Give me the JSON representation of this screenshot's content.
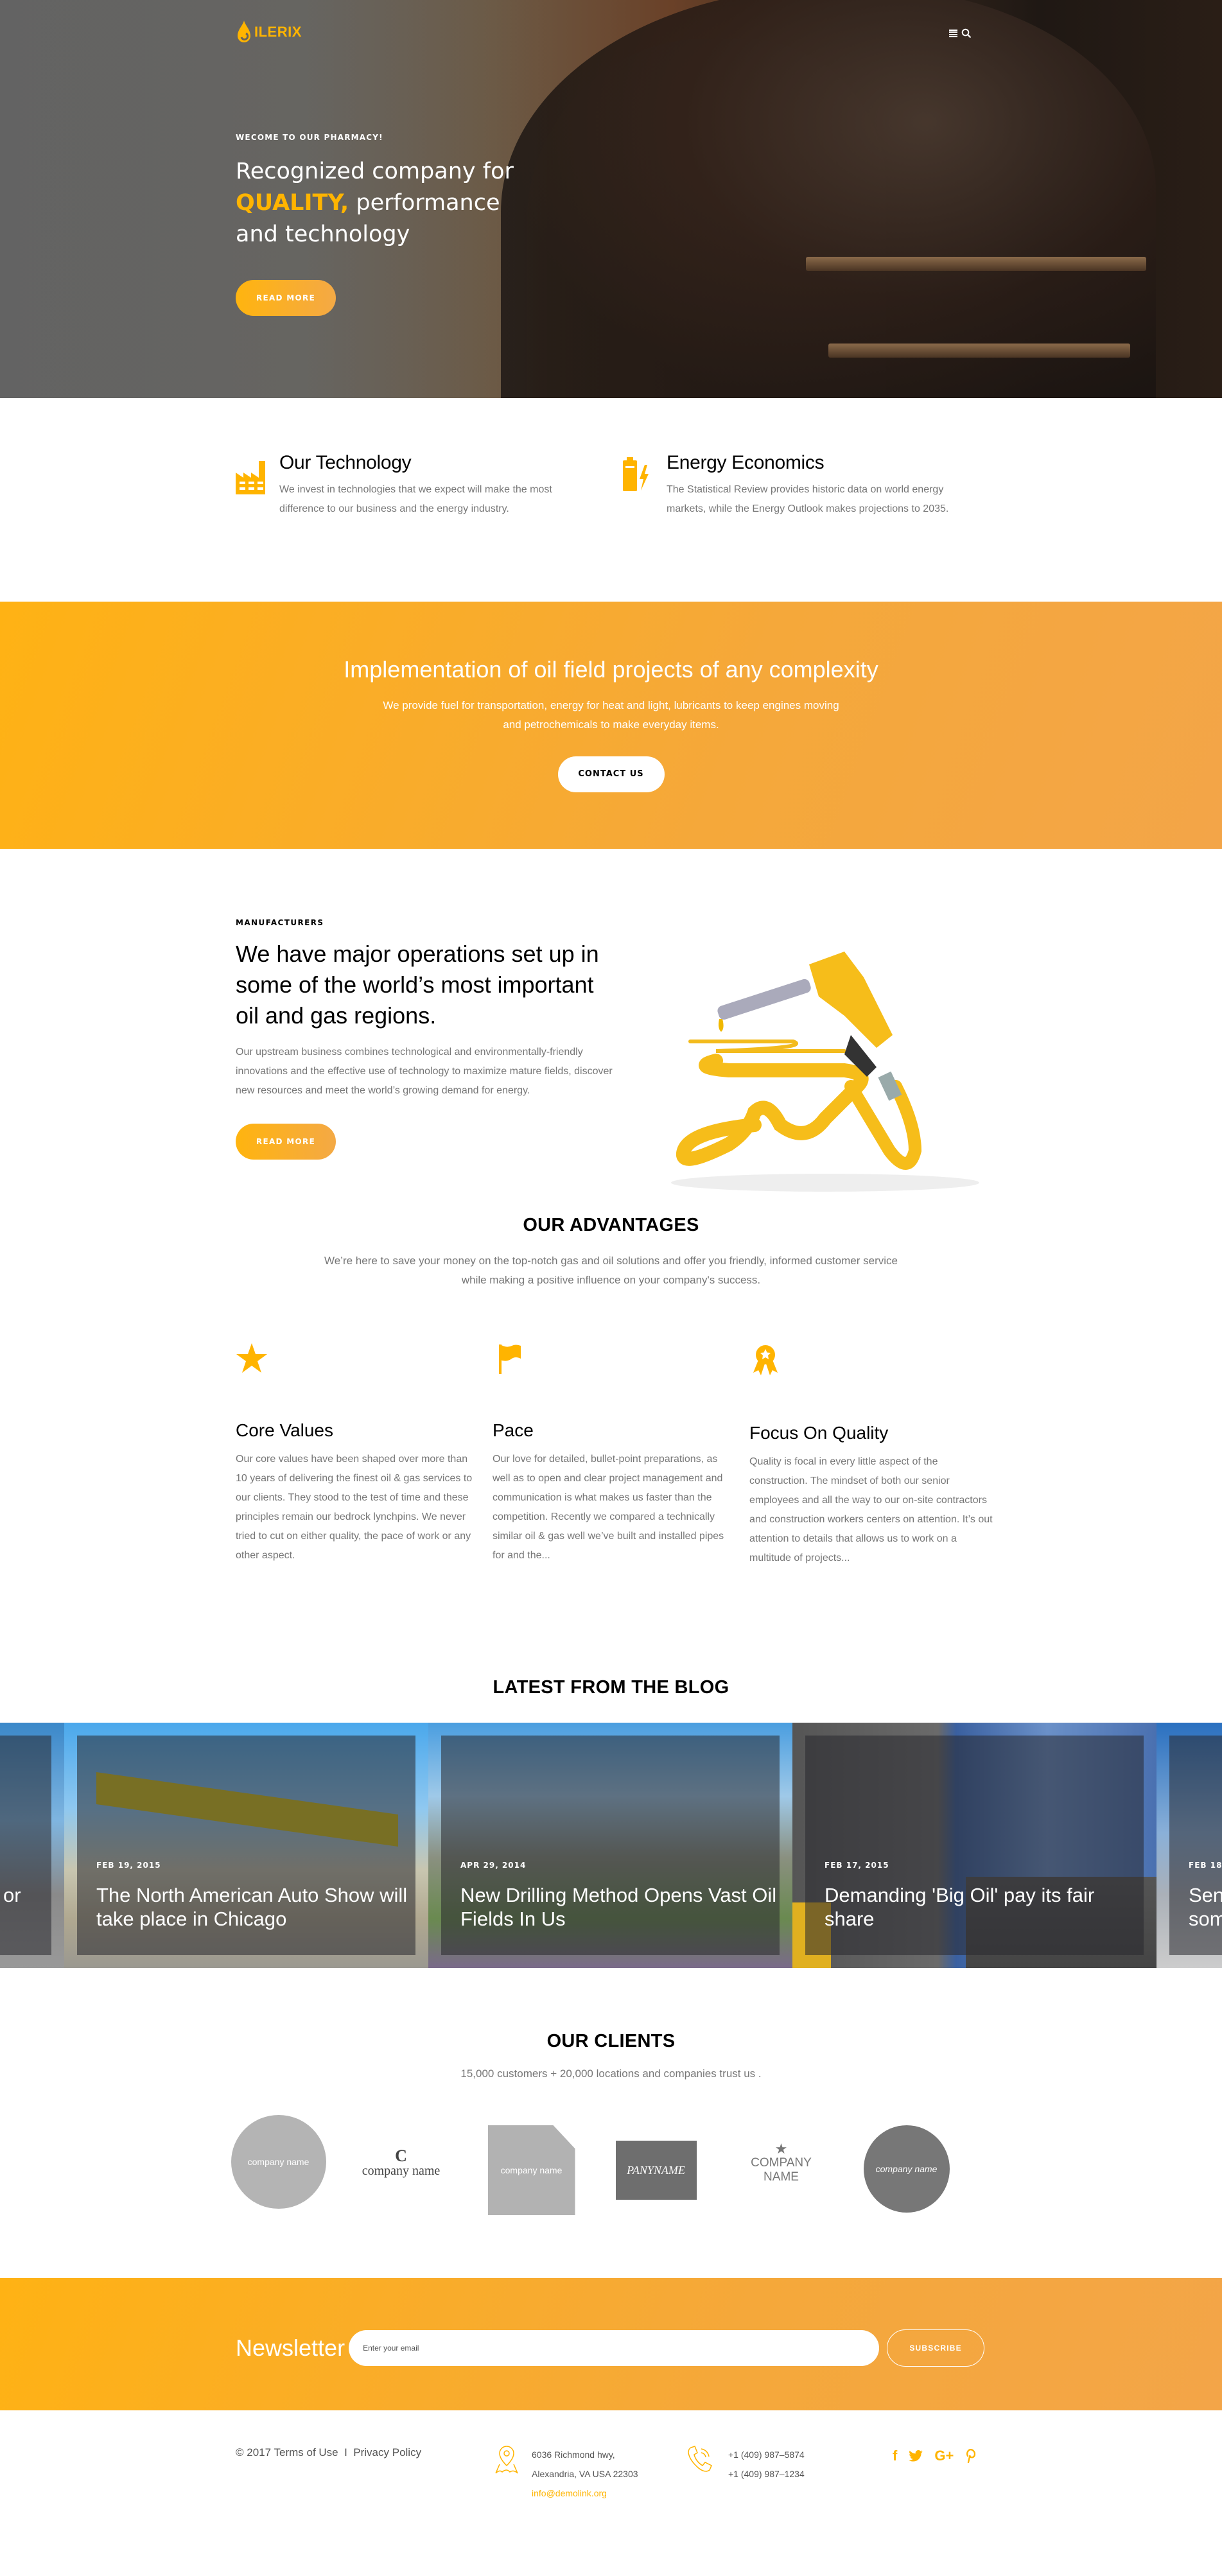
{
  "header": {
    "logo_text": "ILERIX",
    "icons": [
      "menu-icon",
      "search-icon"
    ]
  },
  "hero": {
    "kicker": "WECOME TO OUR PHARMACY!",
    "title_line1": "Recognized company for",
    "title_highlight": "QUALITY,",
    "title_line2_rest": " performance",
    "title_line3": "and technology",
    "button_label": "READ MORE"
  },
  "features": [
    {
      "icon": "factory-icon",
      "title": "Our Technology",
      "text": "We invest in technologies that we expect will make the most difference to our business and the energy industry."
    },
    {
      "icon": "battery-bolt-icon",
      "title": "Energy Economics",
      "text": "The Statistical Review provides historic data on world energy markets, while the Energy Outlook makes projections to 2035."
    }
  ],
  "cta": {
    "title": "Implementation of oil field projects of any complexity",
    "text": "We provide fuel for transportation, energy for heat and light, lubricants to keep engines moving and petrochemicals to make everyday items.",
    "button_label": "CONTACT US"
  },
  "manufacturers": {
    "kicker": "MANUFACTURERS",
    "title": "We have major operations set up in some of the world’s most important oil and gas regions.",
    "text": "Our upstream business combines technological and environmentally-friendly innovations and the effective use of technology to maximize mature fields, discover new resources and meet the world’s growing demand for energy.",
    "button_label": "READ MORE",
    "image": "fuel-nozzle-hose-image"
  },
  "advantages": {
    "title": "OUR ADVANTAGES",
    "subtitle": "We’re here to save your money on the top-notch gas and oil solutions and offer you friendly, informed customer service while making a positive influence on your company's success.",
    "items": [
      {
        "icon": "star-icon",
        "title": "Core Values",
        "text": "Our core values have been shaped over more than 10 years of delivering the finest oil & gas services to our clients. They stood to the test of time and these principles remain our bedrock lynchpins. We never tried to cut on either quality, the pace of work or any other aspect."
      },
      {
        "icon": "flag-icon",
        "title": "Pace",
        "text": "Our love for detailed, bullet-point preparations, as well as to open and clear project management and communication is what makes us faster than the competition. Recently we compared a technically similar oil & gas well we’ve built and installed pipes for and the..."
      },
      {
        "icon": "award-ribbon-icon",
        "title": "Focus On Quality",
        "text": "Quality is focal in every little aspect of the construction. The mindset of both our senior employees and all the way to our on-site contractors and construction workers centers on attention. It’s out attention to details that allows us to work on a multitude of projects..."
      }
    ]
  },
  "blog": {
    "title": "LATEST FROM THE BLOG",
    "posts": [
      {
        "date": "",
        "title": "or",
        "partial": true
      },
      {
        "date": "FEB 19, 2015",
        "title": "The North American Auto Show will take place in Chicago"
      },
      {
        "date": "APR 29, 2014",
        "title": "New Drilling Method Opens Vast Oil Fields In Us"
      },
      {
        "date": "FEB 17, 2015",
        "title": "Demanding 'Big Oil' pay its fair share"
      },
      {
        "date": "FEB 18",
        "title": "Sen som",
        "partial": true
      }
    ]
  },
  "clients": {
    "title": "OUR CLIENTS",
    "subtitle": "15,000 customers + 20,000 locations and companies trust us .",
    "logos": [
      "company name",
      "company name",
      "company name",
      "PANYNAME",
      "COMPANY NAME",
      "company name"
    ]
  },
  "newsletter": {
    "label": "Newsletter",
    "placeholder": "Enter your email",
    "button_label": "SUBSCRIBE"
  },
  "footer": {
    "copyright": "© 2017",
    "terms": "Terms of Use",
    "separator": "I",
    "privacy": "Privacy Policy",
    "address_line1": "6036 Richmond hwy,",
    "address_line2": "Alexandria, VA USA 22303",
    "email": "info@demolink.org",
    "phone1": "+1 (409) 987–5874",
    "phone2": "+1 (409) 987–1234",
    "social": [
      "f",
      "t",
      "G+",
      "p"
    ]
  },
  "colors": {
    "accent": "#ffb400",
    "accent_gradient_end": "#f3a548",
    "text_muted": "#777777"
  }
}
